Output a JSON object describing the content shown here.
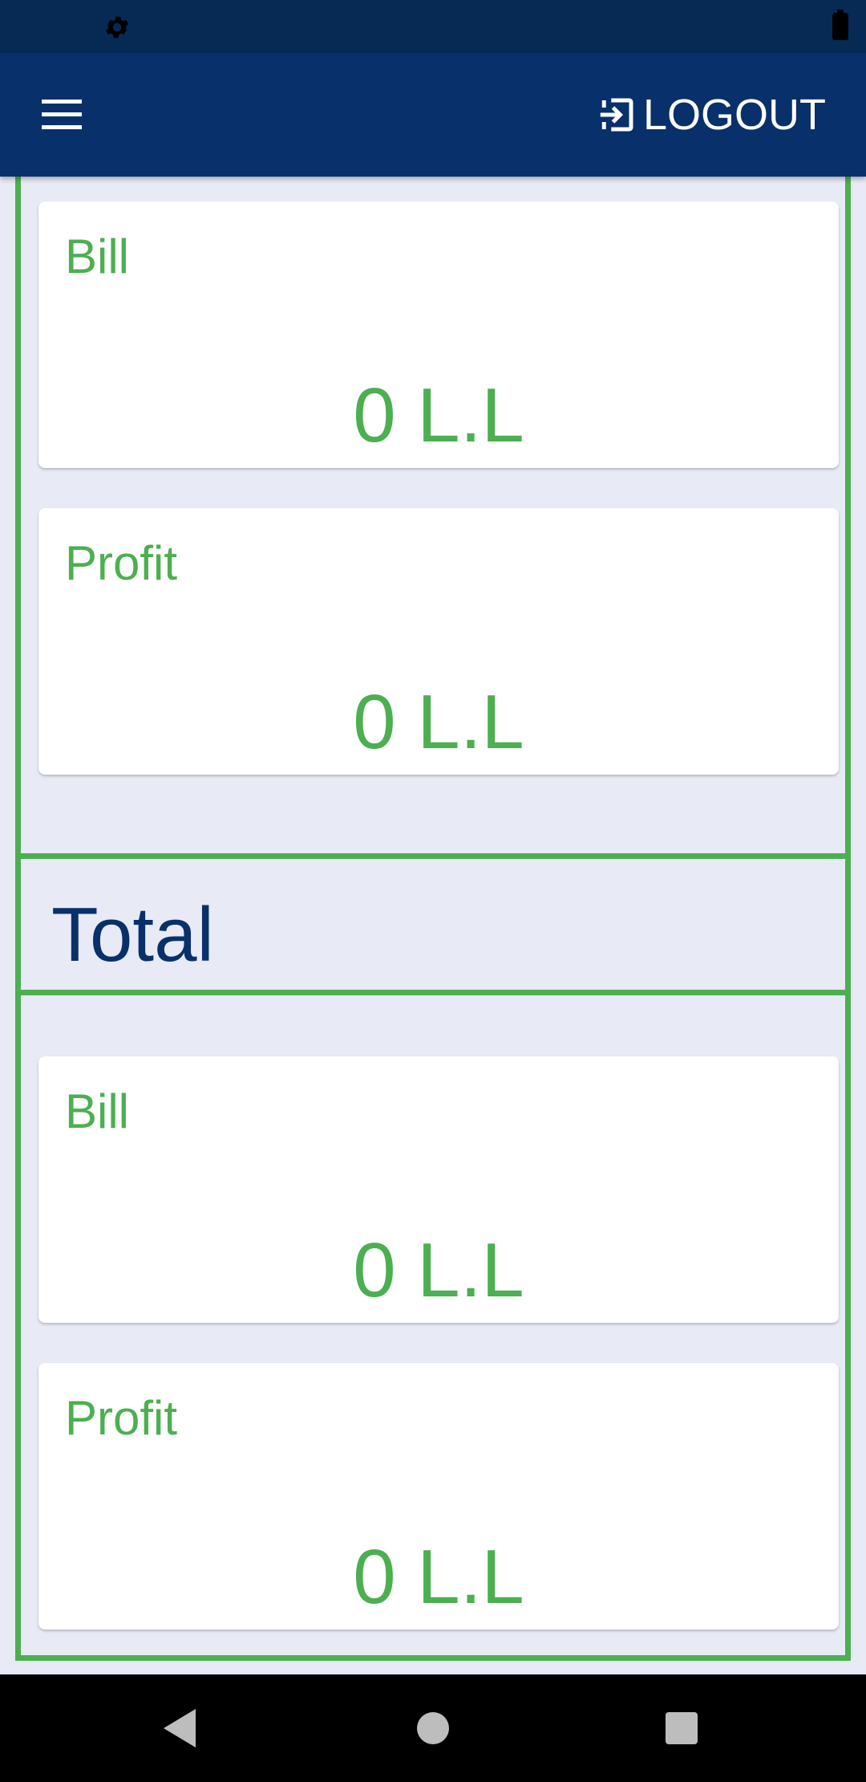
{
  "header": {
    "logout_label": "LOGOUT"
  },
  "sections": [
    {
      "cards": [
        {
          "label": "Bill",
          "value": "0 L.L"
        },
        {
          "label": "Profit",
          "value": "0 L.L"
        }
      ]
    },
    {
      "title": "Total",
      "cards": [
        {
          "label": "Bill",
          "value": "0 L.L"
        },
        {
          "label": "Profit",
          "value": "0 L.L"
        }
      ]
    }
  ],
  "colors": {
    "accent_green": "#4caf50",
    "brand_navy": "#08306b",
    "background": "#e8eaf6"
  }
}
